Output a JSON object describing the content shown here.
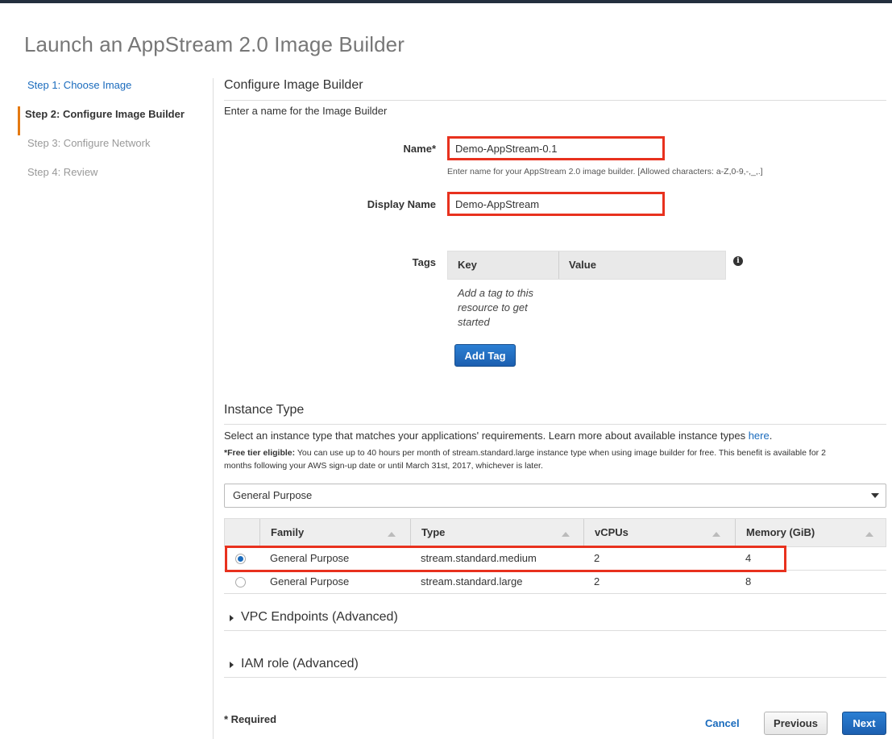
{
  "page": {
    "title": "Launch an AppStream 2.0 Image Builder"
  },
  "steps": [
    {
      "label": "Step 1: Choose Image",
      "state": "link"
    },
    {
      "label": "Step 2: Configure Image Builder",
      "state": "active"
    },
    {
      "label": "Step 3: Configure Network",
      "state": "disabled"
    },
    {
      "label": "Step 4: Review",
      "state": "disabled"
    }
  ],
  "configure": {
    "title": "Configure Image Builder",
    "subtitle": "Enter a name for the Image Builder",
    "name_label": "Name*",
    "name_value": "Demo-AppStream-0.1",
    "name_help": "Enter name for your AppStream 2.0 image builder. [Allowed characters: a-Z,0-9,-,_,.]",
    "display_name_label": "Display Name",
    "display_name_value": "Demo-AppStream",
    "tags_label": "Tags",
    "tags_key_header": "Key",
    "tags_value_header": "Value",
    "tags_empty": "Add a tag to this resource to get started",
    "info_icon": "i",
    "add_tag_label": "Add Tag"
  },
  "instance": {
    "title": "Instance Type",
    "description": "Select an instance type that matches your applications' requirements. Learn more about available instance types",
    "link_text": "here",
    "period": ".",
    "note_bold": "*Free tier eligible:",
    "note_text": " You can use up to 40 hours per month of stream.standard.large instance type when using image builder for free. This benefit is available for 2 months following your AWS sign-up date or until March 31st, 2017, whichever is later.",
    "filter_value": "General Purpose",
    "columns": [
      "Family",
      "Type",
      "vCPUs",
      "Memory (GiB)"
    ],
    "rows": [
      {
        "selected": true,
        "family": "General Purpose",
        "type": "stream.standard.medium",
        "vcpus": "2",
        "memory": "4"
      },
      {
        "selected": false,
        "family": "General Purpose",
        "type": "stream.standard.large",
        "vcpus": "2",
        "memory": "8"
      }
    ]
  },
  "advanced": {
    "vpc": "VPC Endpoints (Advanced)",
    "iam": "IAM role (Advanced)"
  },
  "footer": {
    "required": "* Required",
    "cancel": "Cancel",
    "previous": "Previous",
    "next": "Next"
  },
  "colors": {
    "link": "#1a6bbd",
    "highlight": "#e8311e",
    "active_step_bar": "#e47911",
    "primary_button": "#1c5fb0"
  }
}
